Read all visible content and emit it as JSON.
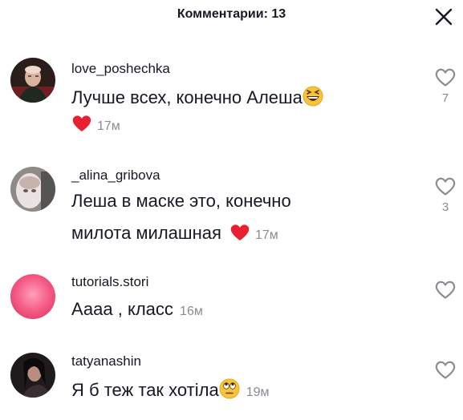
{
  "header": {
    "title": "Комментарии: 13"
  },
  "comments": [
    {
      "username": "love_poshechka",
      "text": "Лучше всех, конечно Алеша",
      "time": "17м",
      "likes": "7"
    },
    {
      "username": "_alina_gribova",
      "text_line1": "Леша в маске это, конечно",
      "text_line2": "милота милашная",
      "time": "17м",
      "likes": "3"
    },
    {
      "username": "tutorials.stori",
      "text": "Аааа , класс",
      "time": "16м",
      "likes": ""
    },
    {
      "username": "tatyanashin",
      "text": "Я б теж так хотіла",
      "time": "19м",
      "likes": ""
    }
  ],
  "colors": {
    "text": "#161823",
    "muted": "#8a8b91",
    "heart": "#e8202f"
  },
  "icons": {
    "close": "close-icon",
    "like": "heart-outline-icon",
    "red_heart": "red-heart-emoji",
    "laughing": "laughing-emoji",
    "eye_roll": "eye-roll-emoji"
  }
}
